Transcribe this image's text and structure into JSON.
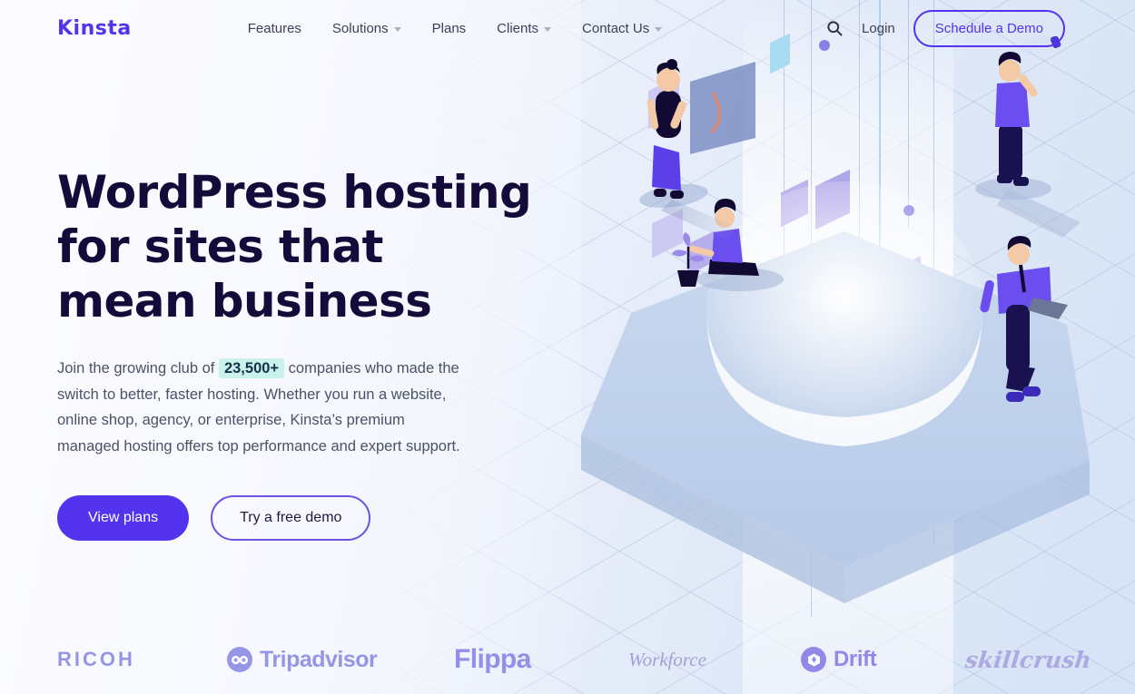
{
  "brand": {
    "name": "Kinsta",
    "accent": "#5333ed",
    "headline_color": "#150b3a"
  },
  "header": {
    "nav": [
      {
        "label": "Features",
        "has_dropdown": false
      },
      {
        "label": "Solutions",
        "has_dropdown": true
      },
      {
        "label": "Plans",
        "has_dropdown": false
      },
      {
        "label": "Clients",
        "has_dropdown": true
      },
      {
        "label": "Contact Us",
        "has_dropdown": true
      }
    ],
    "search_icon": "search-icon",
    "login_label": "Login",
    "demo_label": "Schedule a Demo"
  },
  "hero": {
    "headline_lines": [
      "WordPress hosting",
      "for sites that",
      "mean business"
    ],
    "paragraph_before": "Join the growing club of ",
    "highlight": "23,500+",
    "highlight_bg": "#c9f2ec",
    "paragraph_after": " companies who made the switch to better, faster hosting. Whether you run a website, online shop, agency, or enterprise, Kinsta’s premium managed hosting offers top performance and expert support.",
    "primary_cta": "View plans",
    "secondary_cta": "Try a free demo"
  },
  "clients": [
    {
      "name": "RICOH",
      "style": "wordmark"
    },
    {
      "name": "Tripadvisor",
      "style": "icon-wordmark"
    },
    {
      "name": "Flippa",
      "style": "wordmark"
    },
    {
      "name": "Workforce",
      "style": "serif-wordmark"
    },
    {
      "name": "Drift",
      "style": "icon-wordmark"
    },
    {
      "name": "skillcrush",
      "style": "script-wordmark"
    }
  ]
}
